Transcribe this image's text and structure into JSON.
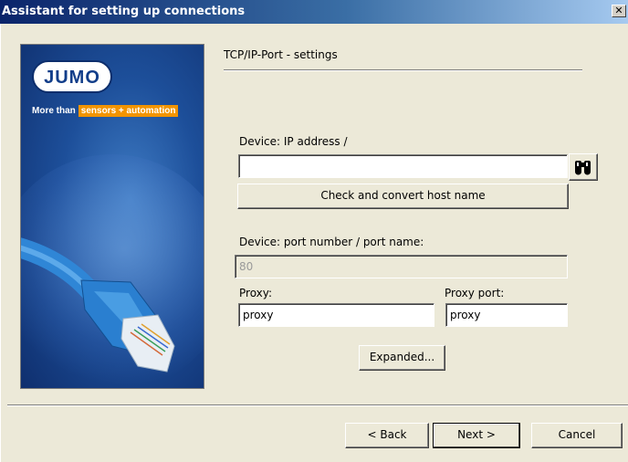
{
  "window": {
    "title": "Assistant for setting up connections",
    "close_glyph": "✕"
  },
  "banner": {
    "logo_text": "JUMO",
    "tagline_prefix": "More than",
    "tagline_sensors": "sensors",
    "tagline_plus": "+",
    "tagline_automation": "automation"
  },
  "page": {
    "section_title": "TCP/IP-Port - settings"
  },
  "device_ip": {
    "label": "Device: IP address /",
    "value": "",
    "find_icon": "binoculars-icon",
    "check_button": "Check and convert host name"
  },
  "device_port": {
    "label": "Device:  port number / port name:",
    "value": "80"
  },
  "proxy": {
    "label": "Proxy:",
    "value": "proxy",
    "port_label": "Proxy port:",
    "port_value": "proxy"
  },
  "expanded_button": "Expanded...",
  "footer": {
    "back": "< Back",
    "next": "Next >",
    "cancel": "Cancel"
  }
}
